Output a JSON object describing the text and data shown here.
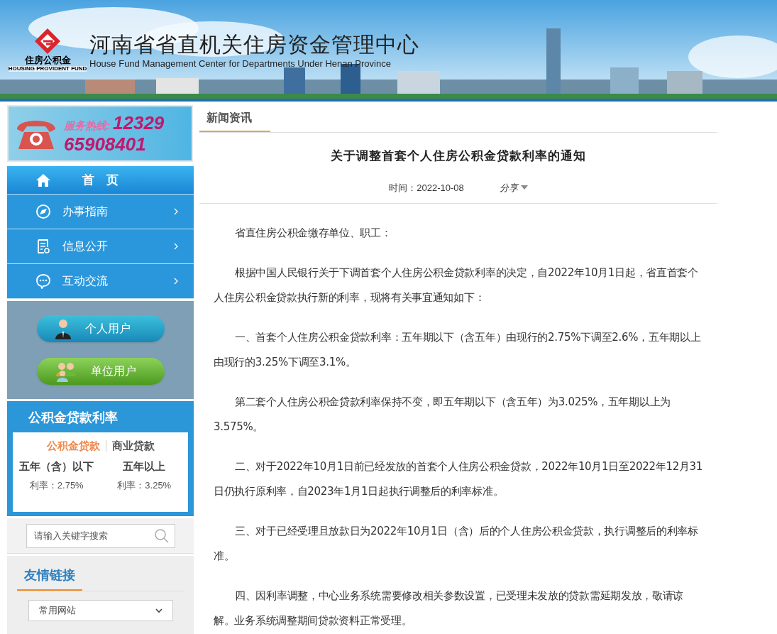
{
  "header": {
    "logo_text": "住房公积金",
    "logo_subtext": "HOUSING PROVIDENT FUND",
    "title": "河南省省直机关住房资金管理中心",
    "subtitle": "House Fund Management Center for Departments Under Henan Province"
  },
  "hotline": {
    "label": "服务热线:",
    "numbers": [
      "12329",
      "65908401"
    ]
  },
  "nav": [
    {
      "label": "首　页",
      "kind": "home",
      "selected": true
    },
    {
      "label": "办事指南",
      "kind": "compass",
      "selected": false
    },
    {
      "label": "信息公开",
      "kind": "document",
      "selected": false
    },
    {
      "label": "互动交流",
      "kind": "chat",
      "selected": false
    }
  ],
  "user_buttons": [
    {
      "label": "个人用户",
      "kind": "personal"
    },
    {
      "label": "单位用户",
      "kind": "company"
    }
  ],
  "rates": {
    "title": "公积金贷款利率",
    "tabs": [
      {
        "label": "公积金贷款",
        "selected": true
      },
      {
        "label": "商业贷款",
        "selected": false
      }
    ],
    "columns": [
      {
        "heading": "五年（含）以下",
        "value": "利率：2.75%"
      },
      {
        "heading": "五年以上",
        "value": "利率：3.25%"
      }
    ]
  },
  "search": {
    "placeholder": "请输入关键字搜索"
  },
  "links": {
    "title": "友情链接",
    "select_value": "常用网站"
  },
  "content": {
    "tab": "新闻资讯",
    "title": "关于调整首套个人住房公积金贷款利率的通知",
    "date": "时间：2022-10-08",
    "share": "分享",
    "paragraphs": [
      "省直住房公积金缴存单位、职工：",
      "根据中国人民银行关于下调首套个人住房公积金贷款利率的决定，自2022年10月1日起，省直首套个人住房公积金贷款执行新的利率，现将有关事宜通知如下：",
      "一、首套个人住房公积金贷款利率：五年期以下（含五年）由现行的2.75%下调至2.6%，五年期以上由现行的3.25%下调至3.1%。",
      "第二套个人住房公积金贷款利率保持不变，即五年期以下（含五年）为3.025%，五年期以上为3.575%。",
      "二、对于2022年10月1日前已经发放的首套个人住房公积金贷款，2022年10月1日至2022年12月31日仍执行原利率，自2023年1月1日起执行调整后的利率标准。",
      "三、对于已经受理且放款日为2022年10月1日（含）后的个人住房公积金贷款，执行调整后的利率标准。",
      "四、因利率调整，中心业务系统需要修改相关参数设置，已受理未发放的贷款需延期发放，敬请谅解。业务系统调整期间贷款资料正常受理。"
    ]
  }
}
